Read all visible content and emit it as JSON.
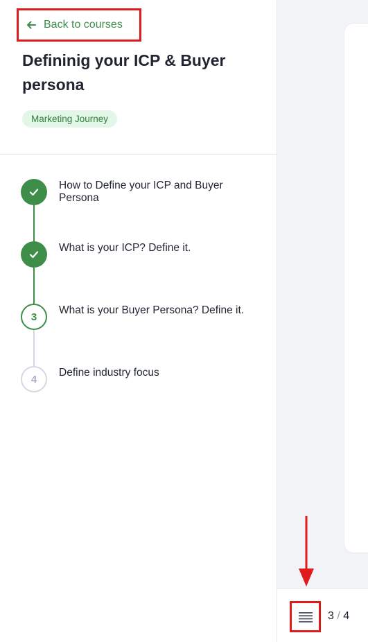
{
  "back_link": {
    "label": "Back to courses"
  },
  "course": {
    "title": "Defininig your ICP & Buyer persona",
    "badge": "Marketing Journey"
  },
  "steps": [
    {
      "number": "1",
      "label": "How to Define your ICP and Buyer Persona",
      "status": "completed"
    },
    {
      "number": "2",
      "label": "What is your ICP? Define it.",
      "status": "completed"
    },
    {
      "number": "3",
      "label": "What is your Buyer Persona? Define it.",
      "status": "current"
    },
    {
      "number": "4",
      "label": "Define industry focus",
      "status": "upcoming"
    }
  ],
  "footer": {
    "current_page": "3",
    "separator": "/",
    "total_pages": "4"
  },
  "colors": {
    "accent_green": "#3e8e4a",
    "badge_bg": "#e3f7e8",
    "highlight_red": "#e01b1b",
    "content_bg": "#f1f3f7"
  },
  "icons": {
    "back": "arrow-left-icon",
    "completed": "check-icon",
    "menu": "hamburger-menu-icon"
  }
}
